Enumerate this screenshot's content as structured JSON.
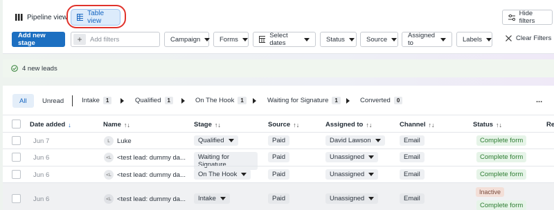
{
  "views": {
    "pipeline_label": "Pipeline view",
    "table_label": "Table view"
  },
  "hide_filters_label": "Hide filters",
  "toolbar": {
    "add_stage_label": "Add new stage",
    "add_filters_placeholder": "Add filters",
    "filters": [
      "Campaign",
      "Forms",
      "Select dates",
      "Status",
      "Source",
      "Assigned to",
      "Labels"
    ],
    "clear_filters_label": "Clear Filters"
  },
  "leads_notice": "4 new leads",
  "tabs": {
    "all": "All",
    "unread": "Unread",
    "stages": [
      {
        "label": "Intake",
        "count": "1"
      },
      {
        "label": "Qualified",
        "count": "1"
      },
      {
        "label": "On The Hook",
        "count": "1"
      },
      {
        "label": "Waiting for Signature",
        "count": "1"
      },
      {
        "label": "Converted",
        "count": "0"
      }
    ],
    "more": "..."
  },
  "table": {
    "columns": [
      "Date added",
      "Name",
      "Stage",
      "Source",
      "Assigned to",
      "Channel",
      "Status",
      "Re"
    ],
    "sort_date": "↓",
    "sort_other": "↑↓",
    "rows": [
      {
        "date": "Jun 7",
        "initials": "L",
        "name": "Luke",
        "stage": "Qualified",
        "source": "Paid",
        "assigned": "David Lawson",
        "channel": "Email",
        "status": "Complete form",
        "extra_status": ""
      },
      {
        "date": "Jun 6",
        "initials": "<L",
        "name": "<test lead: dummy da...",
        "stage": "Waiting for Signature",
        "source": "Paid",
        "assigned": "Unassigned",
        "channel": "Email",
        "status": "Complete form",
        "extra_status": ""
      },
      {
        "date": "Jun 6",
        "initials": "<L",
        "name": "<test lead: dummy da...",
        "stage": "On The Hook",
        "source": "Paid",
        "assigned": "Unassigned",
        "channel": "Email",
        "status": "Complete form",
        "extra_status": ""
      },
      {
        "date": "Jun 6",
        "initials": "<L",
        "name": "<test lead: dummy da...",
        "stage": "Intake",
        "source": "Paid",
        "assigned": "Unassigned",
        "channel": "Email",
        "status": "Complete form",
        "extra_status": "Inactive"
      }
    ]
  },
  "colors": {
    "accent": "#1c6fc1",
    "highlight_ring": "#e0322b",
    "status_green": "#2e7d32"
  }
}
